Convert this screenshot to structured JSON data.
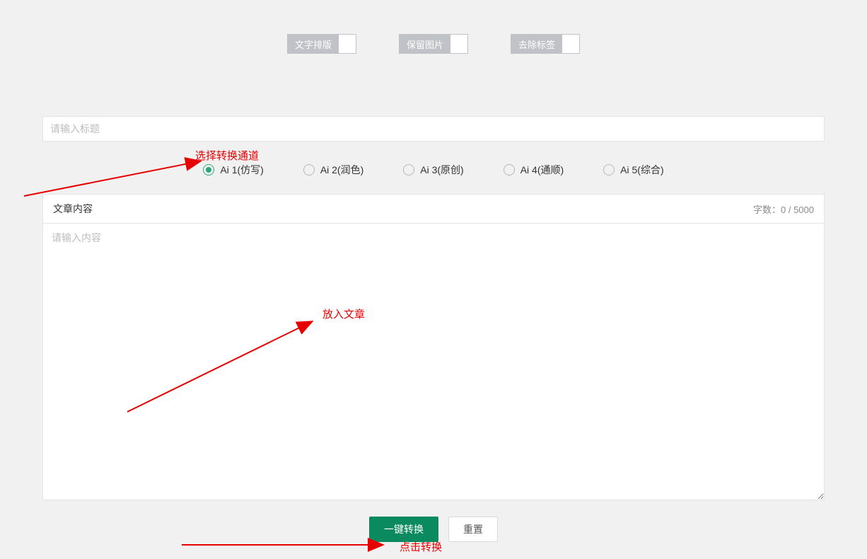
{
  "toolbar": {
    "text_layout": "文字排版",
    "keep_image": "保留图片",
    "remove_tag": "去除标签"
  },
  "title": {
    "placeholder": "请输入标题",
    "value": ""
  },
  "radios": {
    "items": [
      {
        "label": "Ai 1(仿写)",
        "selected": true
      },
      {
        "label": "Ai 2(润色)",
        "selected": false
      },
      {
        "label": "Ai 3(原创)",
        "selected": false
      },
      {
        "label": "Ai 4(通顺)",
        "selected": false
      },
      {
        "label": "Ai 5(综合)",
        "selected": false
      }
    ]
  },
  "content": {
    "header_label": "文章内容",
    "char_count_prefix": "字数：",
    "char_count": "0 / 5000",
    "placeholder": "请输入内容",
    "value": ""
  },
  "actions": {
    "convert": "一键转换",
    "reset": "重置"
  },
  "annotations": {
    "select_channel": "选择转换通道",
    "put_article": "放入文章",
    "click_convert": "点击转换"
  },
  "colors": {
    "primary": "#0b8a5f",
    "radio_accent": "#2aa77a",
    "annotation": "#e60000"
  }
}
